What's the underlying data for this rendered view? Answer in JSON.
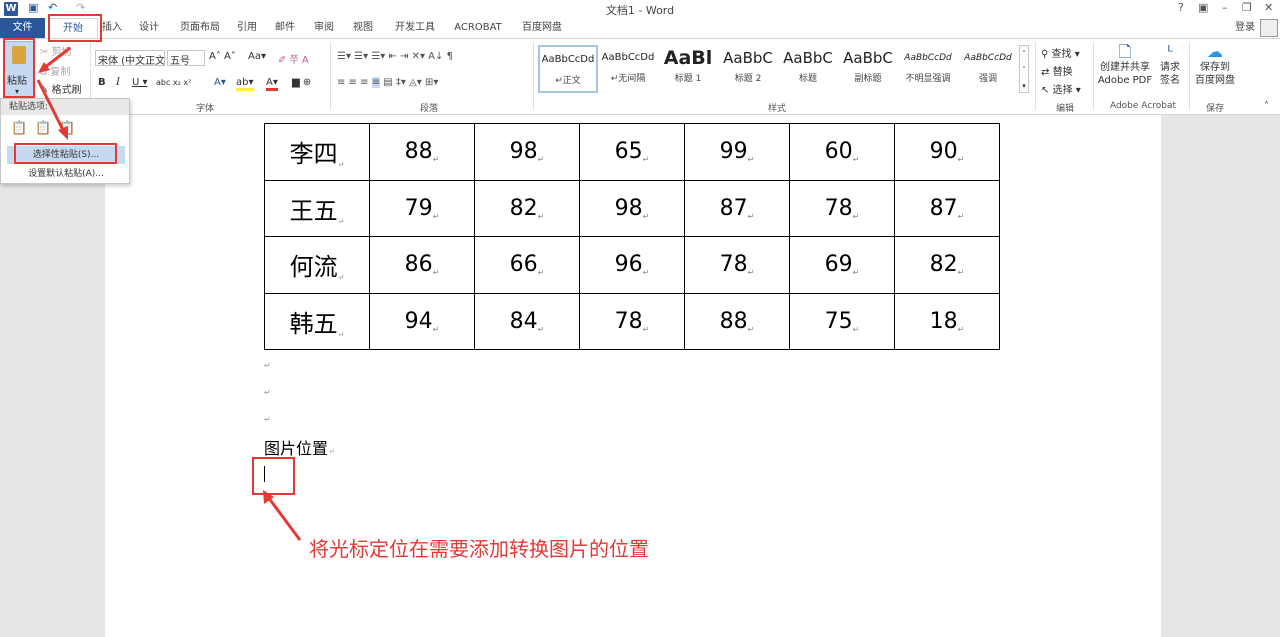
{
  "app": {
    "title": "文档1 - Word",
    "word_icon": "W",
    "help": "?",
    "signin": "登录"
  },
  "tabs": [
    "开始",
    "插入",
    "设计",
    "页面布局",
    "引用",
    "邮件",
    "审阅",
    "视图",
    "开发工具",
    "ACROBAT",
    "百度网盘"
  ],
  "file_tab": "文件",
  "clipboard": {
    "paste": "粘贴",
    "cut": "剪切",
    "copy": "复制",
    "format_painter": "格式刷"
  },
  "font": {
    "name": "宋体 (中文正文",
    "size": "五号",
    "label": "字体"
  },
  "paragraph": {
    "label": "段落"
  },
  "styles": {
    "label": "样式",
    "items": [
      {
        "preview": "AaBbCcDd",
        "name": "↵正文"
      },
      {
        "preview": "AaBbCcDd",
        "name": "↵无间隔"
      },
      {
        "preview": "AaBl",
        "name": "标题 1"
      },
      {
        "preview": "AaBbC",
        "name": "标题 2"
      },
      {
        "preview": "AaBbC",
        "name": "标题"
      },
      {
        "preview": "AaBbC",
        "name": "副标题"
      },
      {
        "preview": "AaBbCcDd",
        "name": "不明显强调"
      },
      {
        "preview": "AaBbCcDd",
        "name": "强调"
      }
    ]
  },
  "editing": {
    "find": "查找",
    "replace": "替换",
    "select": "选择",
    "label": "编辑"
  },
  "acrobat": {
    "create": "创建并共享\nAdobe PDF",
    "sign": "请求\n签名",
    "label": "Adobe Acrobat"
  },
  "save": {
    "btn": "保存到\n百度网盘",
    "label": "保存"
  },
  "paste_menu": {
    "header": "粘贴选项:",
    "special": "选择性粘贴(S)...",
    "default": "设置默认粘贴(A)..."
  },
  "table": [
    {
      "name": "李四",
      "scores": [
        "88",
        "98",
        "65",
        "99",
        "60",
        "90"
      ]
    },
    {
      "name": "王五",
      "scores": [
        "79",
        "82",
        "98",
        "87",
        "78",
        "87"
      ]
    },
    {
      "name": "何流",
      "scores": [
        "86",
        "66",
        "96",
        "78",
        "69",
        "82"
      ]
    },
    {
      "name": "韩五",
      "scores": [
        "94",
        "84",
        "78",
        "88",
        "75",
        "18"
      ]
    }
  ],
  "doc": {
    "image_position": "图片位置"
  },
  "annotation": "将光标定位在需要添加转换图片的位置",
  "colors": {
    "accent": "#2b579a",
    "annotation": "#e53935"
  }
}
